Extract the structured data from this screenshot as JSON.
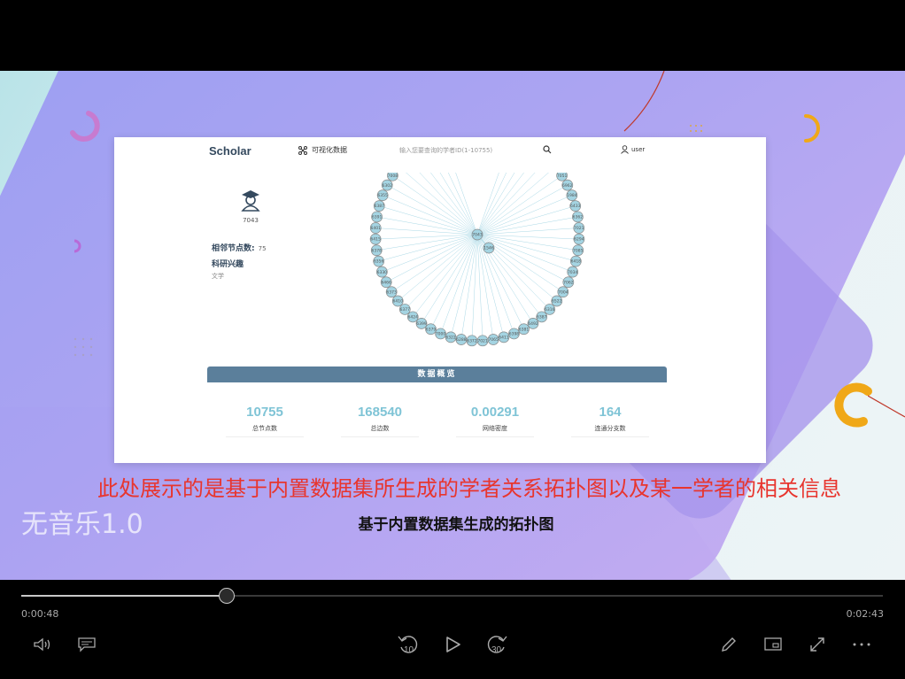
{
  "slide": {
    "webapp": {
      "brand": "Scholar",
      "nav_visualize": "可视化数据",
      "search_placeholder": "输入您要查询的学者ID(1-10755)",
      "user_label": "user",
      "scholar_id": "7043",
      "neighbors_label": "相邻节点数:",
      "neighbors_value": "75",
      "interest_label": "科研兴趣",
      "interest_value": "文学",
      "graph": {
        "center": "7043",
        "inner": "1546",
        "ring": [
          "6424",
          "6492",
          "7055",
          "6442",
          "6411",
          "1550",
          "7051",
          "6962",
          "1984",
          "6433",
          "6362",
          "7021",
          "6294",
          "7085",
          "6418",
          "7034",
          "7062",
          "7004",
          "6522",
          "6316",
          "6387",
          "6492",
          "6381",
          "6398",
          "6411",
          "7065",
          "7021",
          "6372",
          "6288",
          "6322",
          "7000",
          "6379",
          "6399",
          "6424",
          "6377",
          "6410",
          "6373",
          "6466",
          "6330",
          "6356",
          "6378",
          "6415",
          "6401",
          "6391",
          "6387",
          "6355",
          "6302",
          "7008",
          "6381",
          "6383",
          "6322",
          "7044",
          "1564",
          "7009"
        ]
      },
      "overview_title": "数据概览",
      "stats": [
        {
          "value": "10755",
          "label": "总节点数"
        },
        {
          "value": "168540",
          "label": "总边数"
        },
        {
          "value": "0.00291",
          "label": "网络密度"
        },
        {
          "value": "164",
          "label": "连通分支数"
        }
      ]
    },
    "caption_main": "此处展示的是基于内置数据集所生成的学者关系拓扑图以及某一学者的相关信息",
    "caption_sub": "基于内置数据集生成的拓扑图",
    "watermark": "无音乐1.0"
  },
  "player": {
    "current_time": "0:00:48",
    "total_time": "0:02:43",
    "progress": 0.237,
    "rewind_label": "10",
    "forward_label": "30",
    "icons": [
      "volume-icon",
      "subtitles-icon",
      "rewind-10-icon",
      "play-icon",
      "forward-30-icon",
      "pen-icon",
      "cast-icon",
      "fullscreen-icon",
      "more-icon"
    ]
  },
  "colors": {
    "accent": "#7fc4d6",
    "header": "#5b7f9b",
    "caption": "#e8352e",
    "deco_orange": "#f0a818"
  }
}
